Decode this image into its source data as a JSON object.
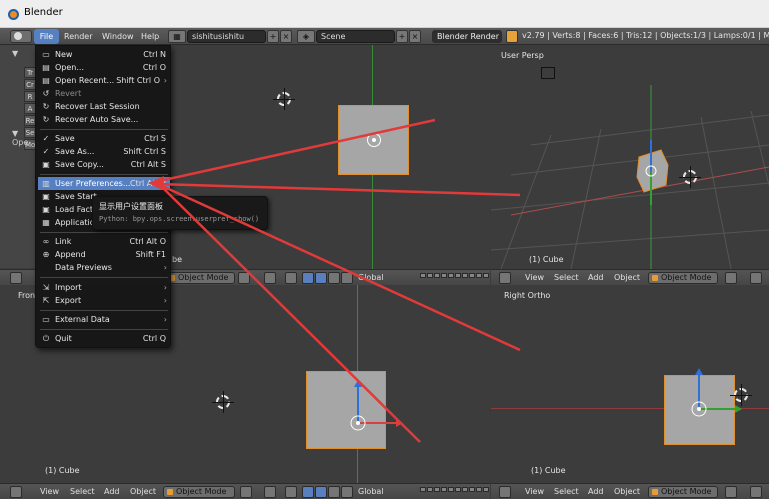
{
  "window": {
    "title": "Blender"
  },
  "header": {
    "menus": [
      "File",
      "Render",
      "Window",
      "Help"
    ],
    "screen_layout": "sishitusishitu",
    "scene": "Scene",
    "render_engine": "Blender Render",
    "stats": "v2.79 | Verts:8 | Faces:6 | Tris:12 | Objects:1/3 | Lamps:0/1 | Mem:18"
  },
  "file_menu": {
    "items": [
      {
        "label": "New",
        "shortcut": "Ctrl N",
        "icon": "new-file-icon"
      },
      {
        "label": "Open...",
        "shortcut": "Ctrl O",
        "icon": "folder-icon"
      },
      {
        "label": "Open Recent...",
        "shortcut": "Shift Ctrl O",
        "icon": "folder-icon",
        "submenu": true
      },
      {
        "label": "Revert",
        "shortcut": "",
        "icon": "revert-icon",
        "disabled": true
      },
      {
        "label": "Recover Last Session",
        "shortcut": "",
        "icon": "recover-icon"
      },
      {
        "label": "Recover Auto Save...",
        "shortcut": "",
        "icon": "recover-icon"
      },
      {
        "label": "Save",
        "shortcut": "Ctrl S",
        "icon": "check-icon"
      },
      {
        "label": "Save As...",
        "shortcut": "Shift Ctrl S",
        "icon": "check-icon"
      },
      {
        "label": "Save Copy...",
        "shortcut": "Ctrl Alt S",
        "icon": "save-copy-icon"
      },
      {
        "label": "User Preferences...",
        "shortcut": "Ctrl Alt U",
        "icon": "preferences-icon",
        "highlighted": true
      },
      {
        "label": "Save Start",
        "shortcut": "",
        "icon": "save-icon"
      },
      {
        "label": "Load Facto",
        "shortcut": "",
        "icon": "load-icon"
      },
      {
        "label": "Application",
        "shortcut": "",
        "icon": "app-icon"
      },
      {
        "label": "Link",
        "shortcut": "Ctrl Alt O",
        "icon": "link-icon"
      },
      {
        "label": "Append",
        "shortcut": "Shift F1",
        "icon": "append-icon"
      },
      {
        "label": "Data Previews",
        "shortcut": "",
        "icon": "",
        "submenu": true
      },
      {
        "label": "Import",
        "shortcut": "",
        "icon": "import-icon",
        "submenu": true
      },
      {
        "label": "Export",
        "shortcut": "",
        "icon": "export-icon",
        "submenu": true
      },
      {
        "label": "External Data",
        "shortcut": "",
        "icon": "external-data-icon",
        "submenu": true
      },
      {
        "label": "Quit",
        "shortcut": "Ctrl Q",
        "icon": "power-icon"
      }
    ]
  },
  "tooltip": {
    "title": "显示用户设置面板",
    "python": "Python: bpy.ops.screen.userpref_show()"
  },
  "viewports": {
    "top_left": {
      "label": "",
      "object": "be"
    },
    "top_right": {
      "label": "User Persp",
      "object": "(1) Cube"
    },
    "bottom_left": {
      "label": "Fron",
      "object": "(1) Cube"
    },
    "bottom_right": {
      "label": "Right Ortho",
      "object": "(1) Cube"
    }
  },
  "footer": {
    "view": "View",
    "select": "Select",
    "add": "Add",
    "object": "Object",
    "mode": "Object Mode",
    "pivot": "Global"
  },
  "shelf": {
    "tabs": [
      "Tr",
      "Cr",
      "R",
      "A",
      "Re",
      "Se",
      "Mo"
    ],
    "operator": "Ope"
  },
  "colors": {
    "highlight": "#5680c2",
    "cube": "#a6a6a6",
    "annotation_arrow": "#e03a3a"
  }
}
